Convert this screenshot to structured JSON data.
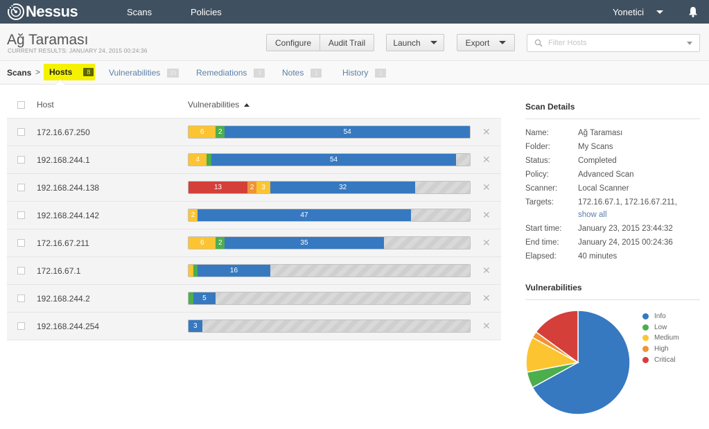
{
  "app": {
    "name": "Nessus"
  },
  "topnav": {
    "scans": "Scans",
    "policies": "Policies",
    "user": "Yonetici"
  },
  "header": {
    "title": "Ağ Taraması",
    "subtitle": "CURRENT RESULTS: JANUARY 24, 2015 00:24:36",
    "buttons": {
      "configure": "Configure",
      "audit_trail": "Audit Trail",
      "launch": "Launch",
      "export": "Export"
    },
    "filter_placeholder": "Filter Hosts"
  },
  "tabs": {
    "breadcrumb": "Scans",
    "breadcrumb_sep": ">",
    "items": [
      {
        "label": "Hosts",
        "count": "8",
        "active": true
      },
      {
        "label": "Vulnerabilities",
        "count": "33"
      },
      {
        "label": "Remediations",
        "count": "3"
      },
      {
        "label": "Notes",
        "count": "1"
      },
      {
        "label": "History",
        "count": "1"
      }
    ]
  },
  "severity_colors": {
    "critical": "#d43f3a",
    "high": "#ee9336",
    "medium": "#fdc431",
    "low": "#4cae4c",
    "info": "#3679c1"
  },
  "host_table": {
    "columns": {
      "host": "Host",
      "vulnerabilities": "Vulnerabilities"
    },
    "sort": "ascending",
    "rows": [
      {
        "host": "172.16.67.250",
        "critical": 0,
        "high": 0,
        "medium": 6,
        "low": 2,
        "info": 54
      },
      {
        "host": "192.168.244.1",
        "critical": 0,
        "high": 0,
        "medium": 4,
        "low": 1,
        "info": 54
      },
      {
        "host": "192.168.244.138",
        "critical": 13,
        "high": 2,
        "medium": 3,
        "low": 0,
        "info": 32
      },
      {
        "host": "192.168.244.142",
        "critical": 0,
        "high": 0,
        "medium": 2,
        "low": 0,
        "info": 47
      },
      {
        "host": "172.16.67.211",
        "critical": 0,
        "high": 0,
        "medium": 6,
        "low": 2,
        "info": 35
      },
      {
        "host": "172.16.67.1",
        "critical": 0,
        "high": 0,
        "medium": 1,
        "low": 1,
        "info": 16
      },
      {
        "host": "192.168.244.2",
        "critical": 0,
        "high": 0,
        "medium": 0,
        "low": 1,
        "info": 5
      },
      {
        "host": "192.168.244.254",
        "critical": 0,
        "high": 0,
        "medium": 0,
        "low": 0,
        "info": 3
      }
    ],
    "max_total": 62
  },
  "scan_details": {
    "title": "Scan Details",
    "rows": [
      {
        "key": "Name:",
        "value": "Ağ Taraması"
      },
      {
        "key": "Folder:",
        "value": "My Scans"
      },
      {
        "key": "Status:",
        "value": "Completed"
      },
      {
        "key": "Policy:",
        "value": "Advanced Scan"
      },
      {
        "key": "Scanner:",
        "value": "Local Scanner"
      },
      {
        "key": "Targets:",
        "value": "172.16.67.1, 172.16.67.211,",
        "link": "show all"
      },
      {
        "key": "Start time:",
        "value": "January 23, 2015 23:44:32"
      },
      {
        "key": "End time:",
        "value": "January 24, 2015 00:24:36"
      },
      {
        "key": "Elapsed:",
        "value": "40 minutes"
      }
    ]
  },
  "chart_data": {
    "type": "pie",
    "title": "Vulnerabilities",
    "legend_position": "right",
    "labels": [
      "Info",
      "Low",
      "Medium",
      "High",
      "Critical"
    ],
    "values": [
      67,
      5,
      11,
      2,
      15
    ],
    "value_unit": "percent (estimated from slice sizes)",
    "colors": [
      "#3679c1",
      "#4cae4c",
      "#fdc431",
      "#ee9336",
      "#d43f3a"
    ]
  }
}
